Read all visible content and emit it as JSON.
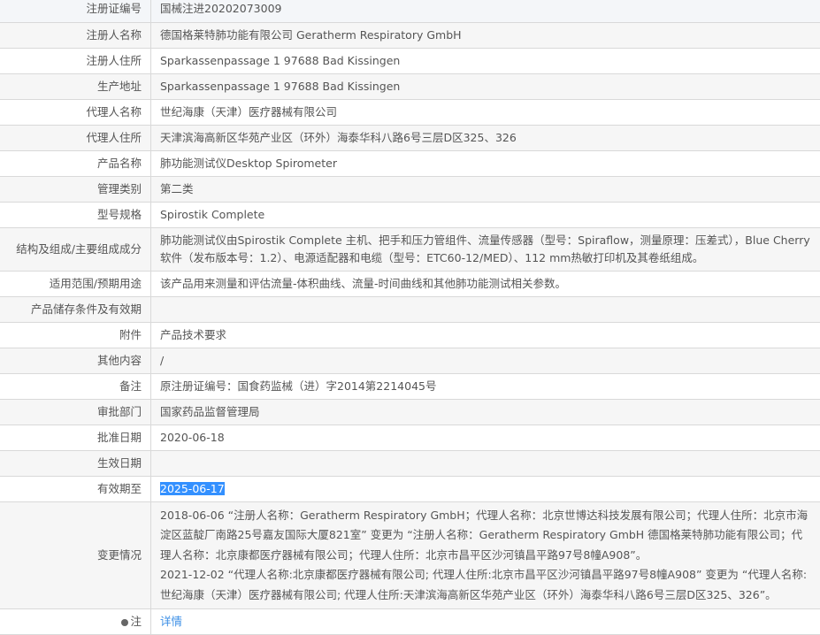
{
  "rows": [
    {
      "label": "注册证编号",
      "value": "国械注进20202073009"
    },
    {
      "label": "注册人名称",
      "value": "德国格莱特肺功能有限公司 Geratherm Respiratory GmbH"
    },
    {
      "label": "注册人住所",
      "value": "Sparkassenpassage 1 97688 Bad Kissingen"
    },
    {
      "label": "生产地址",
      "value": "Sparkassenpassage 1 97688 Bad Kissingen"
    },
    {
      "label": "代理人名称",
      "value": "世纪海康（天津）医疗器械有限公司"
    },
    {
      "label": "代理人住所",
      "value": "天津滨海高新区华苑产业区（环外）海泰华科八路6号三层D区325、326"
    },
    {
      "label": "产品名称",
      "value": "肺功能测试仪Desktop Spirometer"
    },
    {
      "label": "管理类别",
      "value": "第二类"
    },
    {
      "label": "型号规格",
      "value": "Spirostik Complete"
    },
    {
      "label": "结构及组成/主要组成成分",
      "value": "肺功能测试仪由Spirostik Complete 主机、把手和压力管组件、流量传感器（型号：Spiraflow，测量原理：压差式），Blue Cherry 软件（发布版本号：1.2）、电源适配器和电缆（型号：ETC60-12/MED）、112 mm热敏打印机及其卷纸组成。"
    },
    {
      "label": "适用范围/预期用途",
      "value": "该产品用来测量和评估流量-体积曲线、流量-时间曲线和其他肺功能测试相关参数。"
    },
    {
      "label": "产品储存条件及有效期",
      "value": ""
    },
    {
      "label": "附件",
      "value": "产品技术要求"
    },
    {
      "label": "其他内容",
      "value": "/"
    },
    {
      "label": "备注",
      "value": "原注册证编号：国食药监械（进）字2014第2214045号"
    },
    {
      "label": "审批部门",
      "value": "国家药品监督管理局"
    },
    {
      "label": "批准日期",
      "value": "2020-06-18"
    },
    {
      "label": "生效日期",
      "value": ""
    },
    {
      "label": "有效期至",
      "value": "2025-06-17"
    }
  ],
  "changes": {
    "label": "变更情况",
    "entries": [
      "2018-06-06 “注册人名称：Geratherm Respiratory GmbH；代理人名称：北京世博达科技发展有限公司；代理人住所：北京市海淀区蓝靛厂南路25号嘉友国际大厦821室” 变更为 “注册人名称：Geratherm Respiratory GmbH 德国格莱特肺功能有限公司；代理人名称：北京康都医疗器械有限公司；代理人住所：北京市昌平区沙河镇昌平路97号8幢A908”。",
      "2021-12-02 “代理人名称:北京康都医疗器械有限公司; 代理人住所:北京市昌平区沙河镇昌平路97号8幢A908” 变更为 “代理人名称:世纪海康（天津）医疗器械有限公司; 代理人住所:天津滨海高新区华苑产业区（环外）海泰华科八路6号三层D区325、326”。"
    ]
  },
  "note": {
    "label": "注",
    "link": "详情"
  }
}
